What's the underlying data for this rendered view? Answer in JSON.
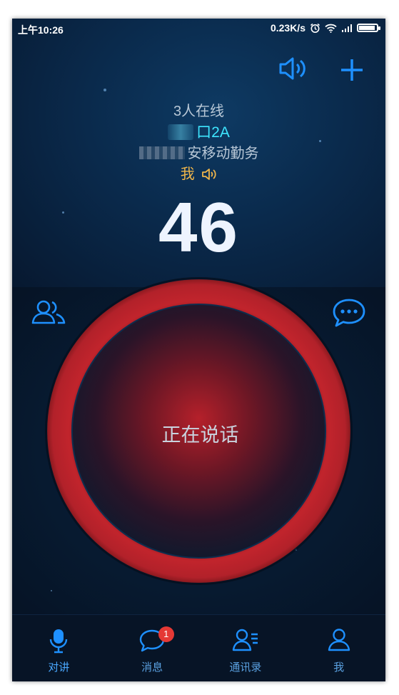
{
  "status_bar": {
    "time": "上午10:26",
    "network_speed": "0.23K/s",
    "battery_level": 0.9
  },
  "top_bar": {
    "speaker_icon": "speaker-icon",
    "add_icon": "plus-icon"
  },
  "group": {
    "online_count": "3人在线",
    "channel_name": "口2A",
    "org_name": "安移动勤务",
    "current_speaker": "我",
    "countdown": "46"
  },
  "side_buttons": {
    "members_icon": "group-icon",
    "chat_icon": "chat-bubble-icon"
  },
  "talk_button": {
    "label": "正在说话"
  },
  "nav": {
    "items": [
      {
        "label": "对讲",
        "icon": "microphone-icon",
        "active": true
      },
      {
        "label": "消息",
        "icon": "message-icon",
        "badge": "1"
      },
      {
        "label": "通讯录",
        "icon": "contacts-icon"
      },
      {
        "label": "我",
        "icon": "person-icon"
      }
    ]
  },
  "colors": {
    "background": "#061325",
    "accent_blue": "#1e90ff",
    "channel_cyan": "#3ee6ff",
    "speaker_gold": "#f0b64a",
    "ring_red": "#c1242c",
    "badge_red": "#e53935"
  }
}
